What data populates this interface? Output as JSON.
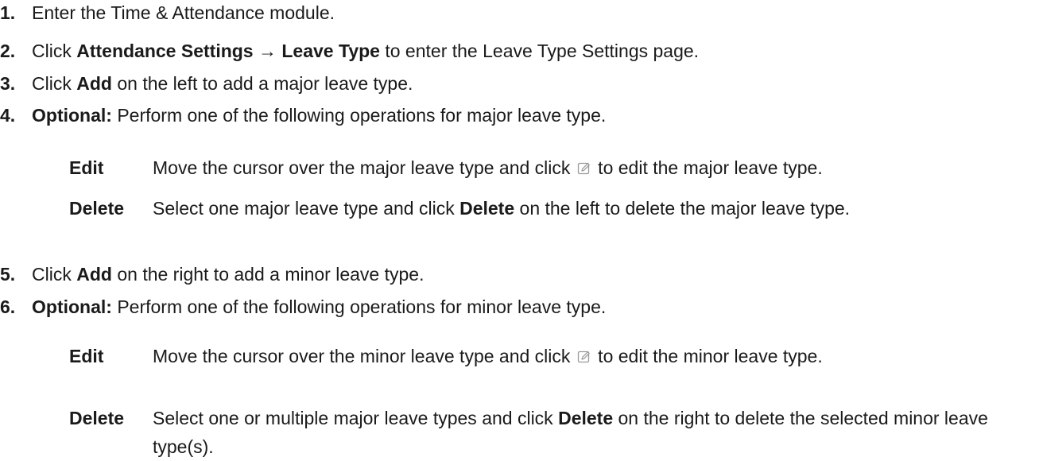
{
  "steps": [
    {
      "num": "1.",
      "text": "Enter the Time & Attendance module."
    },
    {
      "num": "2.",
      "pre": "Click ",
      "bold": "Attendance Settings → Leave Type",
      "post": " to enter the Leave Type Settings page."
    },
    {
      "num": "3.",
      "pre": "Click ",
      "bold": "Add",
      "post": " on the left to add a major leave type."
    },
    {
      "num": "4.",
      "bold": "Optional:",
      "post": " Perform one of the following operations for major leave type."
    },
    {
      "num": "5.",
      "pre": "Click ",
      "bold": "Add",
      "post": " on the right to add a minor leave type."
    },
    {
      "num": "6.",
      "bold": "Optional:",
      "post": " Perform one of the following operations for minor leave type."
    }
  ],
  "major_ops": {
    "edit": {
      "term": "Edit",
      "pre": "Move the cursor over the major leave type and click ",
      "post": " to edit the major leave type."
    },
    "delete": {
      "term": "Delete",
      "pre": "Select one major leave type and click ",
      "bold": "Delete",
      "post": " on the left to delete the major leave type."
    }
  },
  "minor_ops": {
    "edit": {
      "term": "Edit",
      "pre": "Move the cursor over the minor leave type and click ",
      "post": " to edit the minor leave type."
    },
    "delete": {
      "term": "Delete",
      "pre": "Select one or multiple major leave types and click ",
      "bold": "Delete",
      "post": " on the right to delete the selected minor leave type(s)."
    }
  },
  "icons": {
    "edit_icon": "edit-icon",
    "edit_icon_color": "#9a9a9a"
  }
}
